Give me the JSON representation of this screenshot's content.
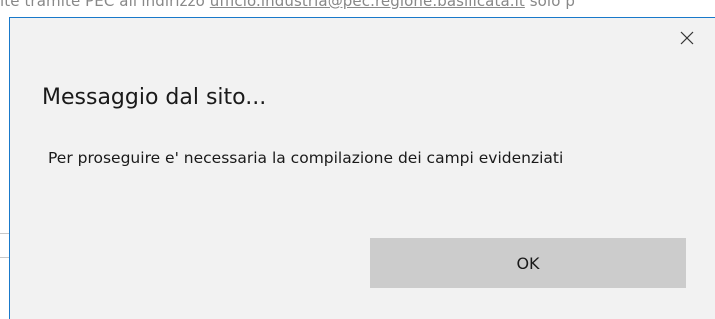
{
  "background": {
    "text_prefix": "ite tramite PEC all'indirizzo ",
    "link_text": "ufficio.industria@pec.regione.basilicata.it",
    "text_suffix": " solo p"
  },
  "dialog": {
    "title": "Messaggio dal sito...",
    "message": "Per proseguire e' necessaria la compilazione dei campi evidenziati",
    "ok_label": "OK",
    "close_icon": "close-icon",
    "accent_color": "#1979ca",
    "button_color": "#cccccc"
  }
}
